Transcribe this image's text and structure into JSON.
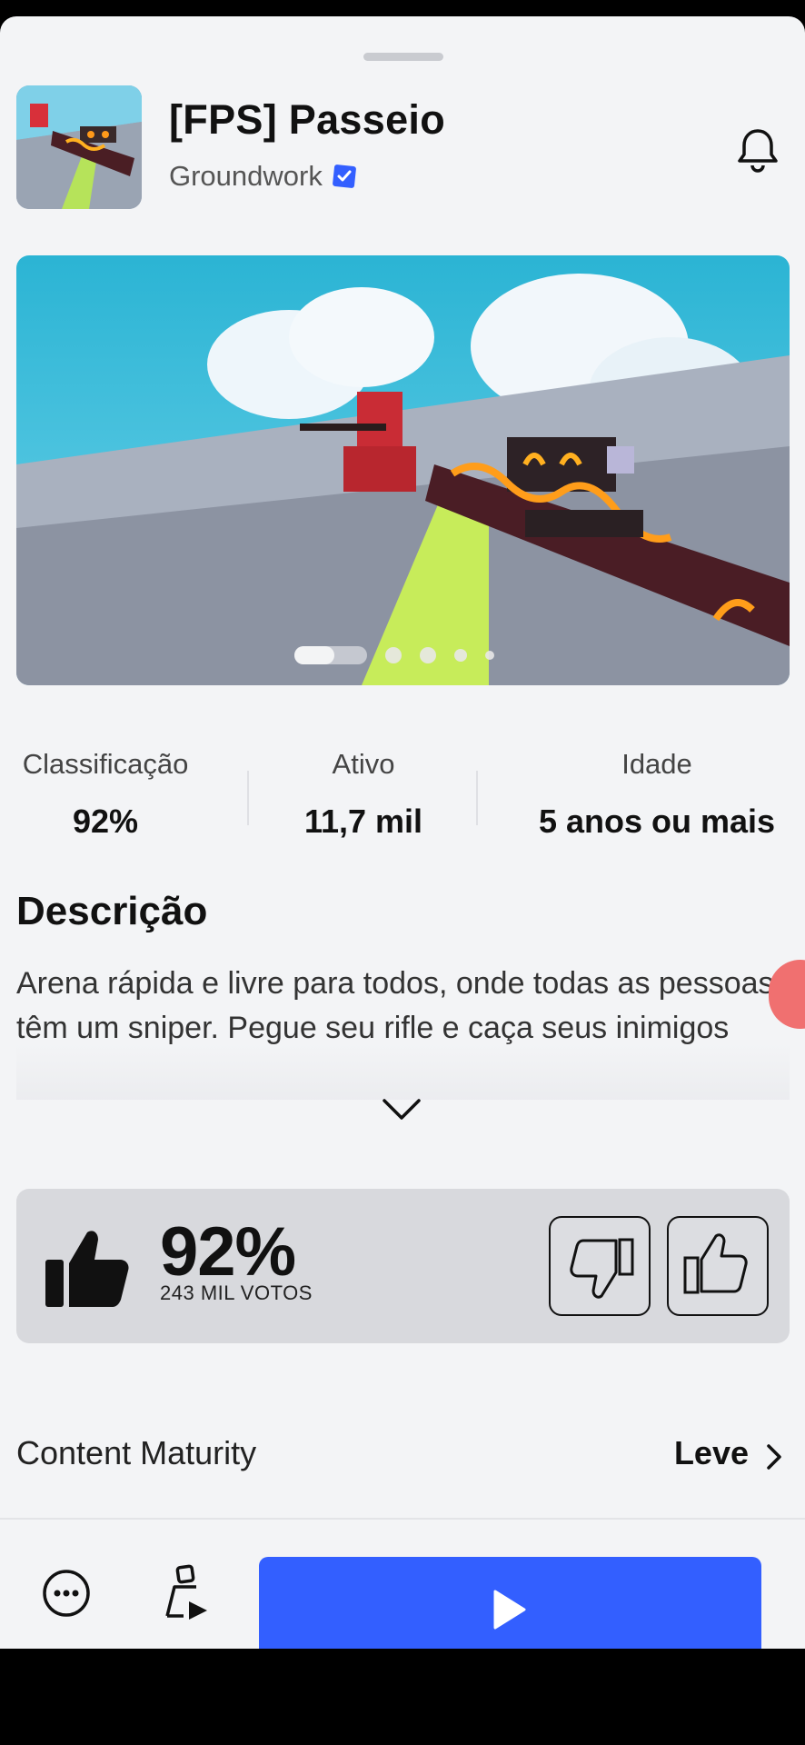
{
  "game": {
    "title": "[FPS] Passeio",
    "creator": "Groundwork",
    "verified": true
  },
  "stats": [
    {
      "label": "Classificação",
      "value": "92%"
    },
    {
      "label": "Ativo",
      "value": "11,7 mil"
    },
    {
      "label": "Idade",
      "value": "5 anos ou mais"
    }
  ],
  "carousel": {
    "pages": 5,
    "active": 1
  },
  "description": {
    "heading": "Descrição",
    "text": "Arena rápida e livre para todos, onde todas as pessoas têm um sniper. Pegue seu rifle e caça seus inimigos"
  },
  "rating": {
    "percent": "92%",
    "votes": "243 MIL VOTOS"
  },
  "content_maturity": {
    "label": "Content Maturity",
    "value": "Leve"
  },
  "icons": {
    "notify": "bell-icon",
    "verified": "verified-badge-icon",
    "expand": "chevron-down-icon",
    "like": "thumbs-up-icon",
    "dislike": "thumbs-down-icon",
    "more": "more-options-icon",
    "party": "party-avatar-icon",
    "play": "play-icon"
  },
  "colors": {
    "play_button": "#335fff",
    "verified": "#335fff",
    "background": "#f3f4f6"
  }
}
